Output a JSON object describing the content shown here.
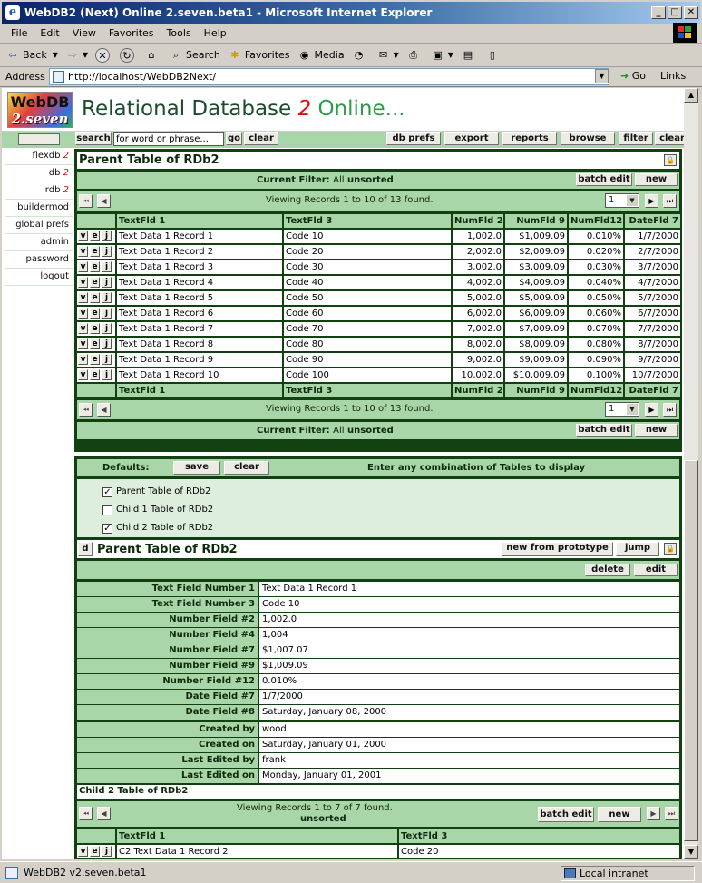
{
  "window": {
    "title": "WebDB2 (Next) Online 2.seven.beta1 - Microsoft Internet Explorer"
  },
  "menu": [
    "File",
    "Edit",
    "View",
    "Favorites",
    "Tools",
    "Help"
  ],
  "toolbar": {
    "back": "Back",
    "search": "Search",
    "favorites": "Favorites",
    "media": "Media"
  },
  "address": {
    "label": "Address",
    "url": "http://localhost/WebDB2Next/",
    "go": "Go",
    "links": "Links"
  },
  "status": {
    "text": "WebDB2 v2.seven.beta1",
    "zone": "Local intranet"
  },
  "banner": {
    "logo_top": "WebDB",
    "logo_bottom": "2.seven",
    "title_a": "Relational Database ",
    "title_b": "2",
    "title_c": " Online..."
  },
  "nav": {
    "search_label": "search",
    "search_value": "for word or phrase...",
    "go": "go",
    "clear": "clear",
    "db_prefs": "db prefs",
    "export": "export",
    "reports": "reports",
    "browse": "browse",
    "filter": "filter",
    "clear2": "clear"
  },
  "sidebar": [
    {
      "label": "flexdb",
      "suffix": "2"
    },
    {
      "label": "db",
      "suffix": "2"
    },
    {
      "label": "rdb",
      "suffix": "2"
    },
    {
      "label": "buildermod",
      "suffix": ""
    },
    {
      "label": "global prefs",
      "suffix": ""
    },
    {
      "label": "admin",
      "suffix": ""
    },
    {
      "label": "password",
      "suffix": ""
    },
    {
      "label": "logout",
      "suffix": ""
    }
  ],
  "table1": {
    "title": "Parent Table of RDb2",
    "filter_label": "Current Filter:",
    "filter_value": "All",
    "filter_sort": "unsorted",
    "batch_edit": "batch edit",
    "new": "new",
    "viewing": "Viewing Records 1 to 10 of 13 found.",
    "page": "1",
    "columns": [
      "TextFld 1",
      "TextFld 3",
      "NumFld 2",
      "NumFld 9",
      "NumFld12",
      "DateFld 7"
    ],
    "rows": [
      [
        "Text Data 1 Record 1",
        "Code 10",
        "1,002.0",
        "$1,009.09",
        "0.010%",
        "1/7/2000"
      ],
      [
        "Text Data 1 Record 2",
        "Code 20",
        "2,002.0",
        "$2,009.09",
        "0.020%",
        "2/7/2000"
      ],
      [
        "Text Data 1 Record 3",
        "Code 30",
        "3,002.0",
        "$3,009.09",
        "0.030%",
        "3/7/2000"
      ],
      [
        "Text Data 1 Record 4",
        "Code 40",
        "4,002.0",
        "$4,009.09",
        "0.040%",
        "4/7/2000"
      ],
      [
        "Text Data 1 Record 5",
        "Code 50",
        "5,002.0",
        "$5,009.09",
        "0.050%",
        "5/7/2000"
      ],
      [
        "Text Data 1 Record 6",
        "Code 60",
        "6,002.0",
        "$6,009.09",
        "0.060%",
        "6/7/2000"
      ],
      [
        "Text Data 1 Record 7",
        "Code 70",
        "7,002.0",
        "$7,009.09",
        "0.070%",
        "7/7/2000"
      ],
      [
        "Text Data 1 Record 8",
        "Code 80",
        "8,002.0",
        "$8,009.09",
        "0.080%",
        "8/7/2000"
      ],
      [
        "Text Data 1 Record 9",
        "Code 90",
        "9,002.0",
        "$9,009.09",
        "0.090%",
        "9/7/2000"
      ],
      [
        "Text Data 1 Record 10",
        "Code 100",
        "10,002.0",
        "$10,009.09",
        "0.100%",
        "10/7/2000"
      ]
    ]
  },
  "defaults": {
    "label": "Defaults:",
    "save": "save",
    "clear": "clear",
    "hint": "Enter any combination of Tables to display",
    "tables": [
      {
        "label": "Parent Table of RDb2",
        "checked": true
      },
      {
        "label": "Child 1 Table of RDb2",
        "checked": false
      },
      {
        "label": "Child 2 Table of RDb2",
        "checked": true
      }
    ]
  },
  "record": {
    "d": "d",
    "title": "Parent Table of RDb2",
    "new_from_prototype": "new from prototype",
    "jump": "jump",
    "delete": "delete",
    "edit": "edit",
    "fields": [
      [
        "Text Field Number 1",
        "Text Data 1 Record 1"
      ],
      [
        "Text Field Number 3",
        "Code 10"
      ],
      [
        "Number Field #2",
        "1,002.0"
      ],
      [
        "Number Field #4",
        "1,004"
      ],
      [
        "Number Field #7",
        "$1,007.07"
      ],
      [
        "Number Field #9",
        "$1,009.09"
      ],
      [
        "Number Field #12",
        "0.010%"
      ],
      [
        "Date Field #7",
        "1/7/2000"
      ],
      [
        "Date Field #8",
        "Saturday, January 08, 2000"
      ]
    ],
    "meta": [
      [
        "Created by",
        "wood"
      ],
      [
        "Created on",
        "Saturday, January 01, 2000"
      ],
      [
        "Last Edited by",
        "frank"
      ],
      [
        "Last Edited on",
        "Monday, January 01, 2001"
      ]
    ]
  },
  "child": {
    "title": "Child 2 Table of RDb2",
    "viewing": "Viewing Records 1 to 7 of 7 found.",
    "sort": "unsorted",
    "batch_edit": "batch edit",
    "new": "new",
    "columns": [
      "TextFld 1",
      "TextFld 3"
    ],
    "rows": [
      [
        "C2 Text Data 1 Record 2",
        "Code 20"
      ]
    ]
  },
  "vej": [
    "v",
    "e",
    "j"
  ]
}
